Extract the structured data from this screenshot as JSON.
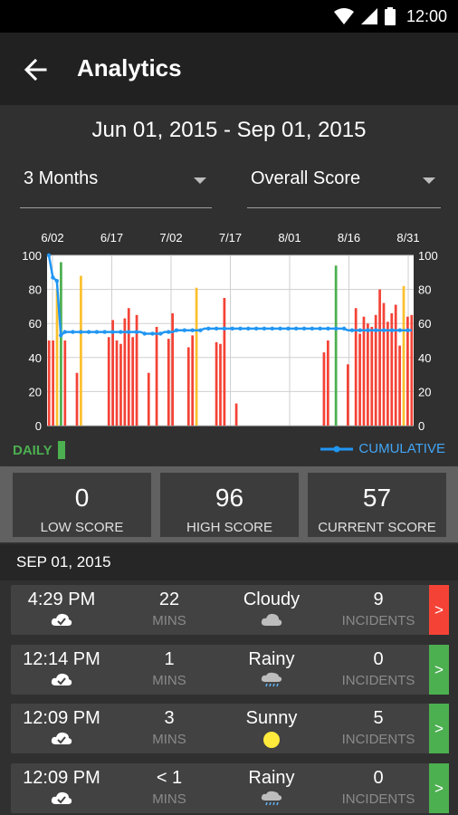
{
  "status_bar": {
    "time": "12:00"
  },
  "app_bar": {
    "title": "Analytics",
    "back_icon": "arrow-left-icon"
  },
  "date_range": "Jun 01, 2015 - Sep 01, 2015",
  "filters": {
    "range_selected": "3 Months",
    "metric_selected": "Overall Score"
  },
  "chart_data": {
    "type": "bar",
    "x_ticks": [
      "6/02",
      "6/17",
      "7/02",
      "7/17",
      "8/01",
      "8/16",
      "8/31"
    ],
    "y_ticks": [
      0,
      20,
      40,
      60,
      80,
      100
    ],
    "ylim": [
      0,
      100
    ],
    "series": [
      {
        "name": "DAILY",
        "values": [
          50,
          50,
          80,
          96,
          50,
          0,
          0,
          31,
          88,
          0,
          0,
          0,
          0,
          0,
          0,
          52,
          62,
          50,
          48,
          63,
          69,
          52,
          65,
          0,
          0,
          31,
          0,
          58,
          0,
          0,
          51,
          66,
          0,
          0,
          0,
          46,
          53,
          81,
          0,
          0,
          0,
          0,
          49,
          48,
          75,
          0,
          0,
          13,
          0,
          0,
          0,
          0,
          0,
          0,
          0,
          0,
          0,
          0,
          0,
          0,
          0,
          0,
          0,
          0,
          0,
          0,
          0,
          0,
          0,
          43,
          50,
          0,
          94,
          0,
          0,
          36,
          0,
          69,
          54,
          64,
          60,
          58,
          65,
          80,
          72,
          61,
          66,
          71,
          47,
          82,
          64,
          65
        ],
        "colors_note": "red default, green=high, yellow=notable",
        "highlights": {
          "green": [
            3,
            72
          ],
          "yellow": [
            2,
            8,
            37,
            89
          ]
        }
      },
      {
        "name": "CUMULATIVE",
        "values": [
          100,
          87,
          85,
          53,
          55,
          55,
          55,
          55,
          55,
          55,
          55,
          55,
          55,
          55,
          55,
          55,
          55,
          55,
          55,
          55,
          55,
          55,
          55,
          55,
          54,
          54,
          54,
          54,
          54,
          55,
          55,
          55,
          56,
          56,
          56,
          56,
          56,
          56,
          56,
          57,
          57,
          57,
          57,
          57,
          57,
          57,
          57,
          57,
          57,
          57,
          57,
          57,
          57,
          57,
          57,
          57,
          57,
          57,
          57,
          57,
          57,
          57,
          57,
          57,
          57,
          57,
          57,
          57,
          57,
          57,
          57,
          57,
          57,
          57,
          57,
          56,
          56,
          56,
          56,
          56,
          56,
          56,
          56,
          56,
          56,
          56,
          56,
          56,
          56,
          56,
          56,
          56
        ]
      }
    ],
    "legend": {
      "daily_label": "DAILY",
      "cumulative_label": "CUMULATIVE"
    }
  },
  "stats": [
    {
      "value": "0",
      "label": "LOW SCORE"
    },
    {
      "value": "96",
      "label": "HIGH SCORE"
    },
    {
      "value": "57",
      "label": "CURRENT SCORE"
    }
  ],
  "section": {
    "date": "SEP 01, 2015"
  },
  "sessions": [
    {
      "time": "4:29 PM",
      "duration": "22",
      "duration_unit": "MINS",
      "weather": "Cloudy",
      "weather_icon": "cloud-icon",
      "incidents": "9",
      "incidents_label": "INCIDENTS",
      "status": "red",
      "go": ">"
    },
    {
      "time": "12:14 PM",
      "duration": "1",
      "duration_unit": "MINS",
      "weather": "Rainy",
      "weather_icon": "rain-icon",
      "incidents": "0",
      "incidents_label": "INCIDENTS",
      "status": "green",
      "go": ">"
    },
    {
      "time": "12:09 PM",
      "duration": "3",
      "duration_unit": "MINS",
      "weather": "Sunny",
      "weather_icon": "sun-icon",
      "incidents": "5",
      "incidents_label": "INCIDENTS",
      "status": "green",
      "go": ">"
    },
    {
      "time": "12:09 PM",
      "duration": "< 1",
      "duration_unit": "MINS",
      "weather": "Rainy",
      "weather_icon": "rain-icon",
      "incidents": "0",
      "incidents_label": "INCIDENTS",
      "status": "green",
      "go": ">"
    }
  ],
  "colors": {
    "red": "#f44336",
    "green": "#4caf50",
    "yellow": "#fbc02d",
    "blue": "#2196f3"
  }
}
